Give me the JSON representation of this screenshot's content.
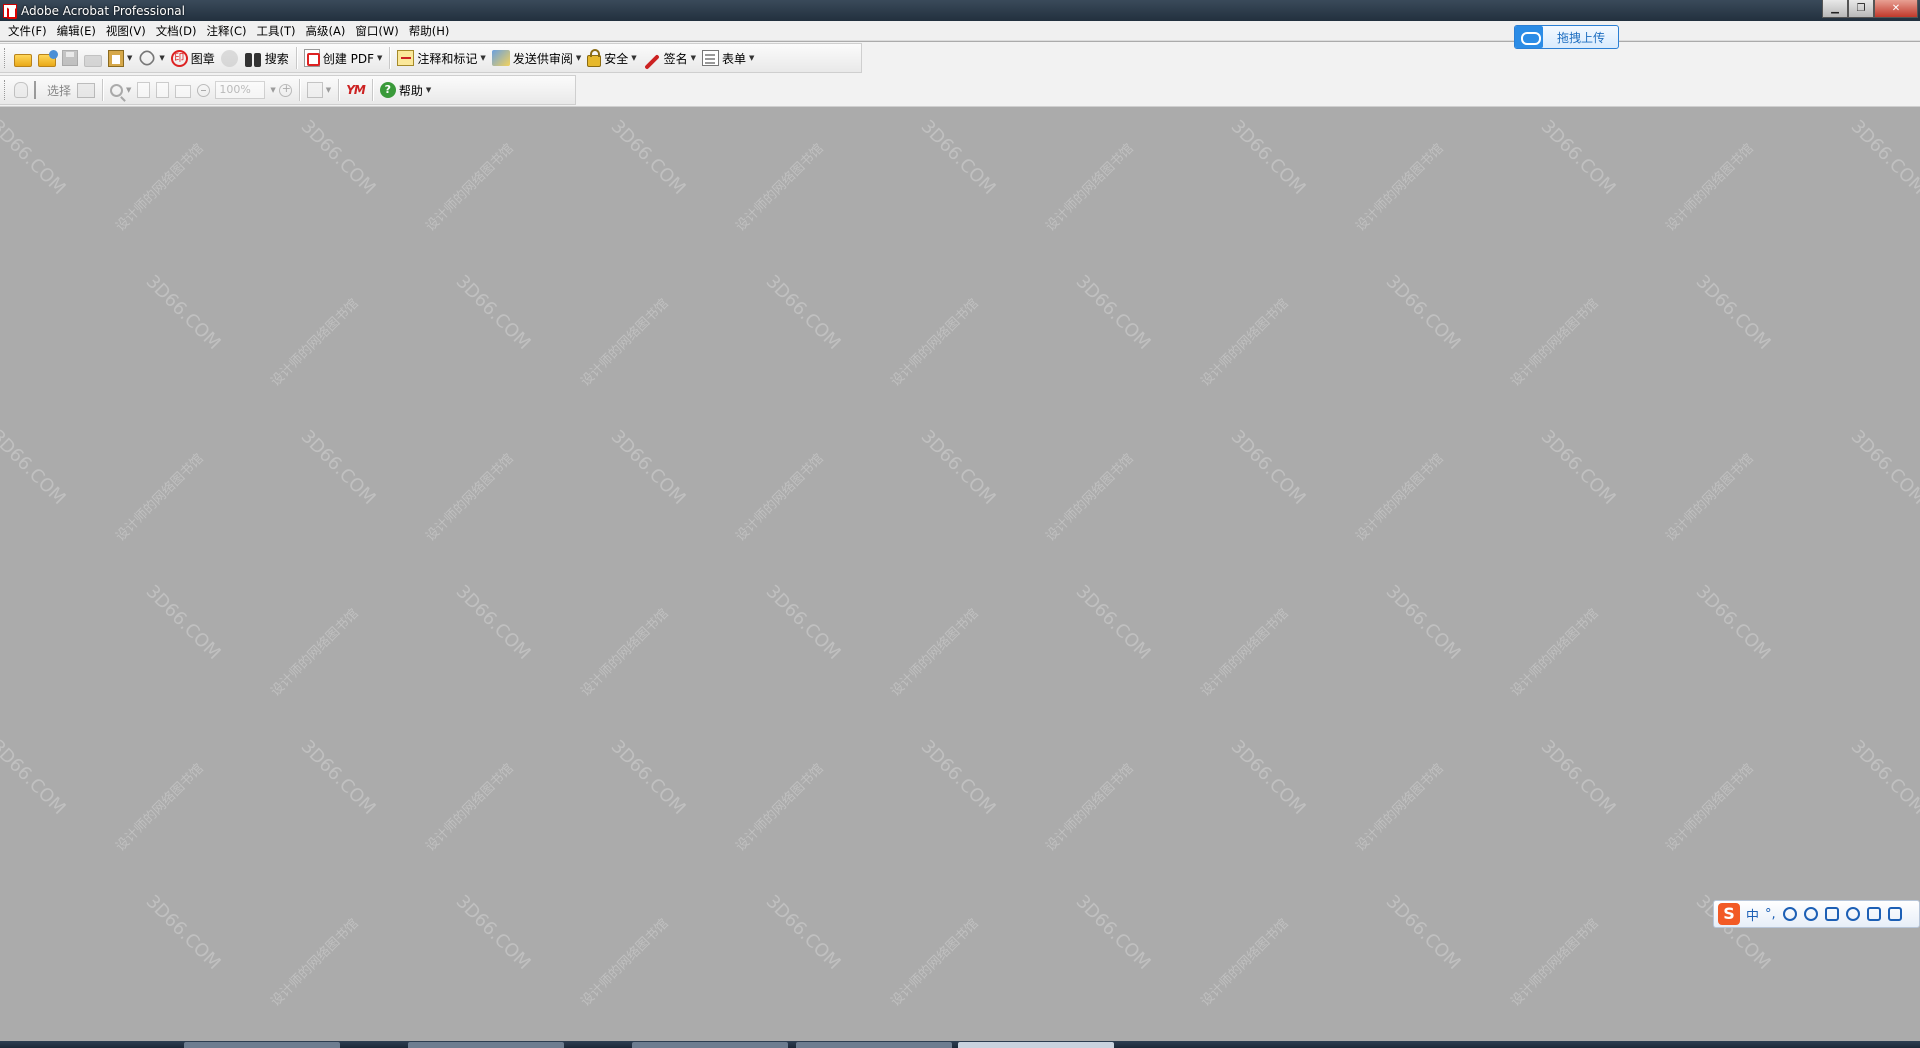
{
  "window": {
    "title": "Adobe Acrobat Professional",
    "controls": [
      "minimize",
      "restore",
      "close"
    ]
  },
  "menu": [
    "文件(F)",
    "编辑(E)",
    "视图(V)",
    "文档(D)",
    "注释(C)",
    "工具(T)",
    "高级(A)",
    "窗口(W)",
    "帮助(H)"
  ],
  "toolbar1": {
    "stamp_label": "图章",
    "search_label": "搜索",
    "create_pdf_label": "创建 PDF",
    "comment_label": "注释和标记",
    "review_label": "发送供审阅",
    "security_label": "安全",
    "sign_label": "签名",
    "forms_label": "表单"
  },
  "toolbar2": {
    "select_label": "选择",
    "zoom_value": "100%",
    "ym_logo": "YM",
    "help_label": "帮助"
  },
  "upload": {
    "label": "拖拽上传"
  },
  "ime": {
    "logo": "S",
    "mode": "中",
    "punct": "°,"
  },
  "watermarks": {
    "site": "3D66.COM",
    "line": "设计师的网络图书馆"
  },
  "colors": {
    "doc_background": "#ababab",
    "accent_red": "#d22222",
    "baidu_blue": "#2b8ce6"
  }
}
